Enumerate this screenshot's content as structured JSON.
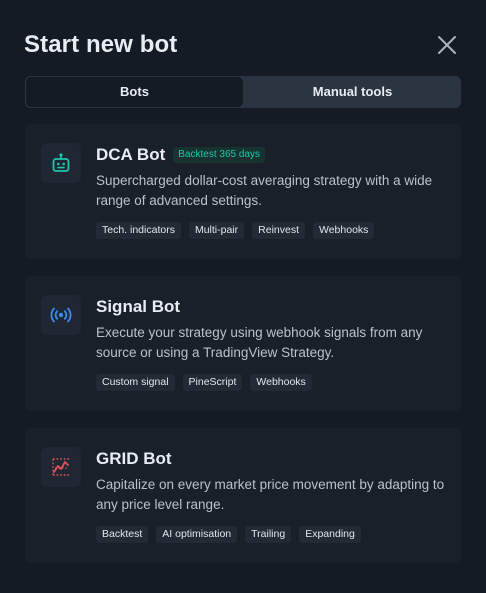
{
  "dialog": {
    "title": "Start new bot",
    "close_icon": "close-icon"
  },
  "tabs": [
    {
      "label": "Bots",
      "active": true
    },
    {
      "label": "Manual tools",
      "active": false
    }
  ],
  "bots": [
    {
      "name": "DCA Bot",
      "icon": "robot-icon",
      "badge": "Backtest 365 days",
      "description": "Supercharged dollar-cost averaging strategy with a wide range of advanced settings.",
      "tags": [
        "Tech. indicators",
        "Multi-pair",
        "Reinvest",
        "Webhooks"
      ]
    },
    {
      "name": "Signal Bot",
      "icon": "signal-broadcast-icon",
      "description": "Execute your strategy using webhook signals from any source or using a TradingView Strategy.",
      "tags": [
        "Custom signal",
        "PineScript",
        "Webhooks"
      ]
    },
    {
      "name": "GRID Bot",
      "icon": "grid-chart-icon",
      "description": "Capitalize on every market price movement by adapting to any price level range.",
      "tags": [
        "Backtest",
        "AI optimisation",
        "Trailing",
        "Expanding"
      ]
    }
  ],
  "colors": {
    "background": "#151b24",
    "card": "#19202a",
    "teal": "#1fc6ae",
    "blue": "#3d8bf2",
    "red": "#e0525f"
  }
}
